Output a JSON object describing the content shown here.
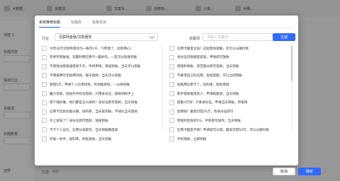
{
  "app": {
    "tabs": [
      {
        "label": "大数据..."
      },
      {
        "label": "关键词..."
      },
      {
        "label": "文案写..."
      },
      {
        "label": "创意标..."
      },
      {
        "label": "小说..."
      },
      {
        "label": "大纲..."
      }
    ],
    "left_labels": [
      "创建 1",
      "标题内容",
      "投放行业",
      "关键词",
      "标题数量",
      "选择"
    ]
  },
  "modal": {
    "tabs": [
      "系统推荐标题",
      "标题库",
      "批量添加"
    ],
    "industry_label": "行业",
    "industry_value": "互联网金融/贷款服务",
    "keyword_label": "关键词",
    "keyword_placeholder": "请输入关键词",
    "generate_label": "生成",
    "left_items": [
      "今年30万贷款利率仅为~每月1千，气死我了，别有用心！",
      "年终奖到账啦，双赢利用信用卡~最好的，一是可以快速到账",
      "不借钱也能快速借到千元，手机申请，快速到账，当天可以到账",
      "不用抵押的无抵押贷款，每天放款，当天可以到账",
      "想借5万，申请个人信用贷款，秒到账审批，一分钟到账",
      "魔力贷款，轻松凭手机号借款，只用身份证，放款到你手上",
      "借个钱好难，你们都是怎么搞的？身份证即可放款，当天到账",
      "信用卡还款也能分期，低利率，当天就到账，不排队当天放款",
      "手上紧张了？身份证即可借款，快速到账",
      "不卡个人征信，信用分高即可，当天到账额度高",
      "开发一条件，低利率，秒批放款，当天到账"
    ],
    "right_items": [
      "信用卡额度太低？这招帮你提额，还可以分期付款",
      "身份证贷款额度提高，申请即可放款",
      "借钱秒到账，有芝麻分即可借款，当天到账",
      "不要求自己的信用，轻松提额，可以立即到账",
      "别再用信用卡了，低利率，轻松借钱",
      "新手借款能借多少，申请就能借，当天到账",
      "提额3万块！只要身份证，申请当天到账，审核快",
      "急用钱？最高可借20万，有身份证即可",
      "借钱利息低到1%，手机即可操作，当天到账",
      "信用卡额度不够？申请就可以借，最高可借50万，可以分期付款",
      "手机借款，立即到账"
    ],
    "selected_label": "已选",
    "selected_count": "4/9",
    "cancel_label": "取消",
    "ok_label": "确定"
  },
  "colors": {
    "accent": "#2f6bff",
    "overlay": "rgba(0,0,0,0.38)"
  }
}
